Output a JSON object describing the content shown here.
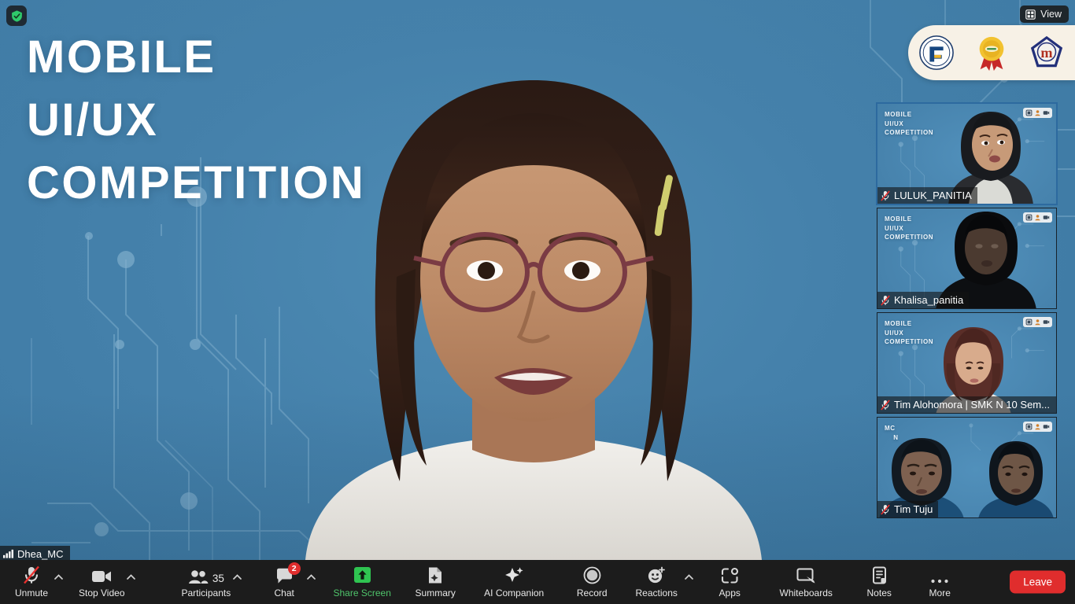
{
  "app": {
    "encryption_icon": "shield-check-icon",
    "view_button": {
      "label": "View",
      "icon": "grid-view-icon"
    }
  },
  "shared_slide": {
    "lines": [
      "MOBILE",
      "UI/UX",
      "COMPETITION"
    ],
    "background_color": "#4581ab",
    "text_color": "#ffffff"
  },
  "logo_strip": {
    "logos": [
      "institution-logo-icon",
      "award-ribbon-icon",
      "organization-m-logo-icon"
    ]
  },
  "active_speaker": {
    "name": "Dhea_MC",
    "signal_icon": "signal-bars-icon"
  },
  "filmstrip": {
    "participants": [
      {
        "name": "LULUK_PANITIA",
        "muted": true,
        "mic_icon": "mic-off-icon",
        "slide_lines": [
          "MOBILE",
          "UI/UX",
          "COMPETITION"
        ],
        "controls": [
          "pin-icon",
          "person-icon",
          "camera-icon"
        ]
      },
      {
        "name": "Khalisa_panitia",
        "muted": true,
        "mic_icon": "mic-off-icon",
        "slide_lines": [
          "MOBILE",
          "UI/UX",
          "COMPETITION"
        ],
        "controls": [
          "pin-icon",
          "person-icon",
          "camera-icon"
        ]
      },
      {
        "name": "Tim Alohomora | SMK N 10 Sem...",
        "muted": true,
        "mic_icon": "mic-off-icon",
        "slide_lines": [
          "MOBILE",
          "UI/UX",
          "COMPETITION"
        ],
        "controls": [
          "pin-icon",
          "person-icon",
          "camera-icon"
        ]
      },
      {
        "name": "Tim Tuju",
        "muted": true,
        "mic_icon": "mic-off-icon",
        "slide_lines": [
          "MC",
          "N"
        ],
        "controls": [
          "pin-icon",
          "person-icon",
          "camera-icon"
        ]
      }
    ]
  },
  "toolbar": {
    "audio": {
      "label": "Unmute",
      "icon": "mic-off-icon",
      "has_caret": true
    },
    "video": {
      "label": "Stop Video",
      "icon": "video-camera-icon",
      "has_caret": true
    },
    "participants": {
      "label": "Participants",
      "icon": "people-icon",
      "count": "35",
      "has_caret": true
    },
    "chat": {
      "label": "Chat",
      "icon": "chat-bubble-icon",
      "badge": "2",
      "has_caret": true
    },
    "share": {
      "label": "Share Screen",
      "icon": "share-screen-up-arrow-icon",
      "color": "#4fc46b"
    },
    "summary": {
      "label": "Summary",
      "icon": "summary-document-icon"
    },
    "ai": {
      "label": "AI Companion",
      "icon": "ai-sparkle-icon"
    },
    "record": {
      "label": "Record",
      "icon": "record-circle-icon"
    },
    "reactions": {
      "label": "Reactions",
      "icon": "smiley-plus-icon",
      "has_caret": true
    },
    "apps": {
      "label": "Apps",
      "icon": "apps-icon"
    },
    "whiteboards": {
      "label": "Whiteboards",
      "icon": "whiteboard-icon"
    },
    "notes": {
      "label": "Notes",
      "icon": "notes-icon"
    },
    "more": {
      "label": "More",
      "icon": "ellipsis-icon"
    },
    "leave": {
      "label": "Leave",
      "color": "#e02d2d"
    }
  }
}
